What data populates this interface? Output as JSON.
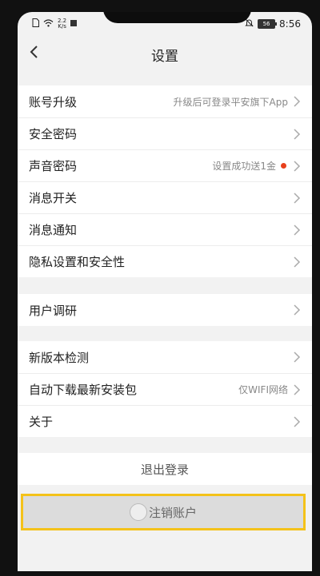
{
  "status_bar": {
    "net_speed_value": "2.2",
    "net_speed_unit": "K/s",
    "battery_level": "56",
    "time": "8:56"
  },
  "header": {
    "title": "设置",
    "back_icon": "chevron-left-icon"
  },
  "groups": [
    {
      "items": [
        {
          "label": "账号升级",
          "value": "升级后可登录平安旗下App"
        },
        {
          "label": "安全密码",
          "value": ""
        },
        {
          "label": "声音密码",
          "value": "设置成功送1金",
          "badge": "red-dot"
        },
        {
          "label": "消息开关",
          "value": ""
        },
        {
          "label": "消息通知",
          "value": ""
        },
        {
          "label": "隐私设置和安全性",
          "value": ""
        }
      ]
    },
    {
      "items": [
        {
          "label": "用户调研",
          "value": ""
        }
      ]
    },
    {
      "items": [
        {
          "label": "新版本检测",
          "value": ""
        },
        {
          "label": "自动下载最新安装包",
          "value": "仅WIFI网络"
        },
        {
          "label": "关于",
          "value": ""
        }
      ]
    }
  ],
  "logout_label": "退出登录",
  "cancel_account_label": "注销账户",
  "colors": {
    "highlight_border": "#f4c21a",
    "badge_red": "#e8401c",
    "background": "#f2f2f2"
  }
}
